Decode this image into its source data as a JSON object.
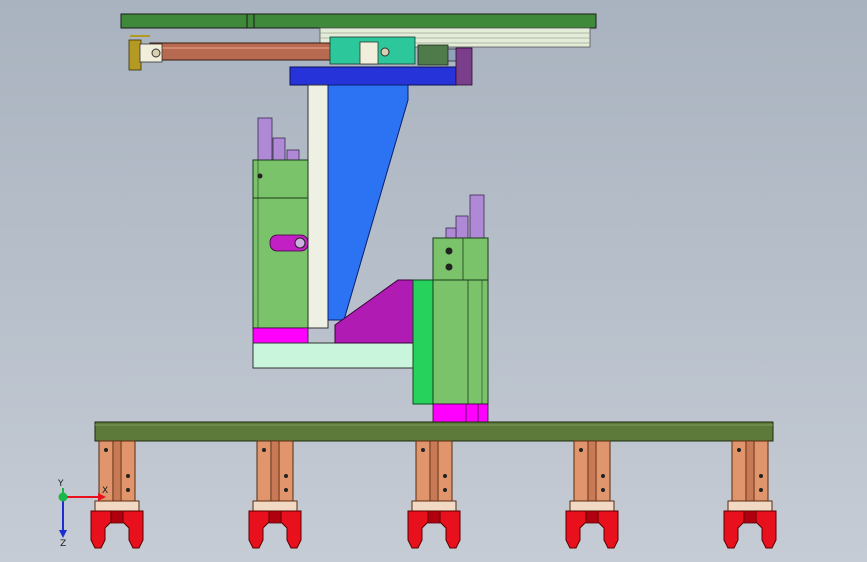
{
  "viewport": {
    "colors": {
      "background_top": "#a9b3bf",
      "background_bottom": "#c6ccd5",
      "top_rail": "#3f8a3a",
      "cylinder": "#b86a50",
      "blue_plate": "#2633d8",
      "blue_gusset": "#2b73f2",
      "green_block": "#7ac36a",
      "bright_green": "#27d25c",
      "magenta": "#ff00ff",
      "purple_gusset": "#b01bb4",
      "mint_plate": "#c9f5dc",
      "rod_lilac": "#b089d6",
      "base_bar": "#5e7a3a",
      "finger": "#e0956d",
      "gripper_red": "#e8101c"
    },
    "triad": {
      "labels": {
        "x": "X",
        "y": "Y",
        "z": "Z"
      },
      "icon": "coordinate-triad-icon"
    }
  }
}
